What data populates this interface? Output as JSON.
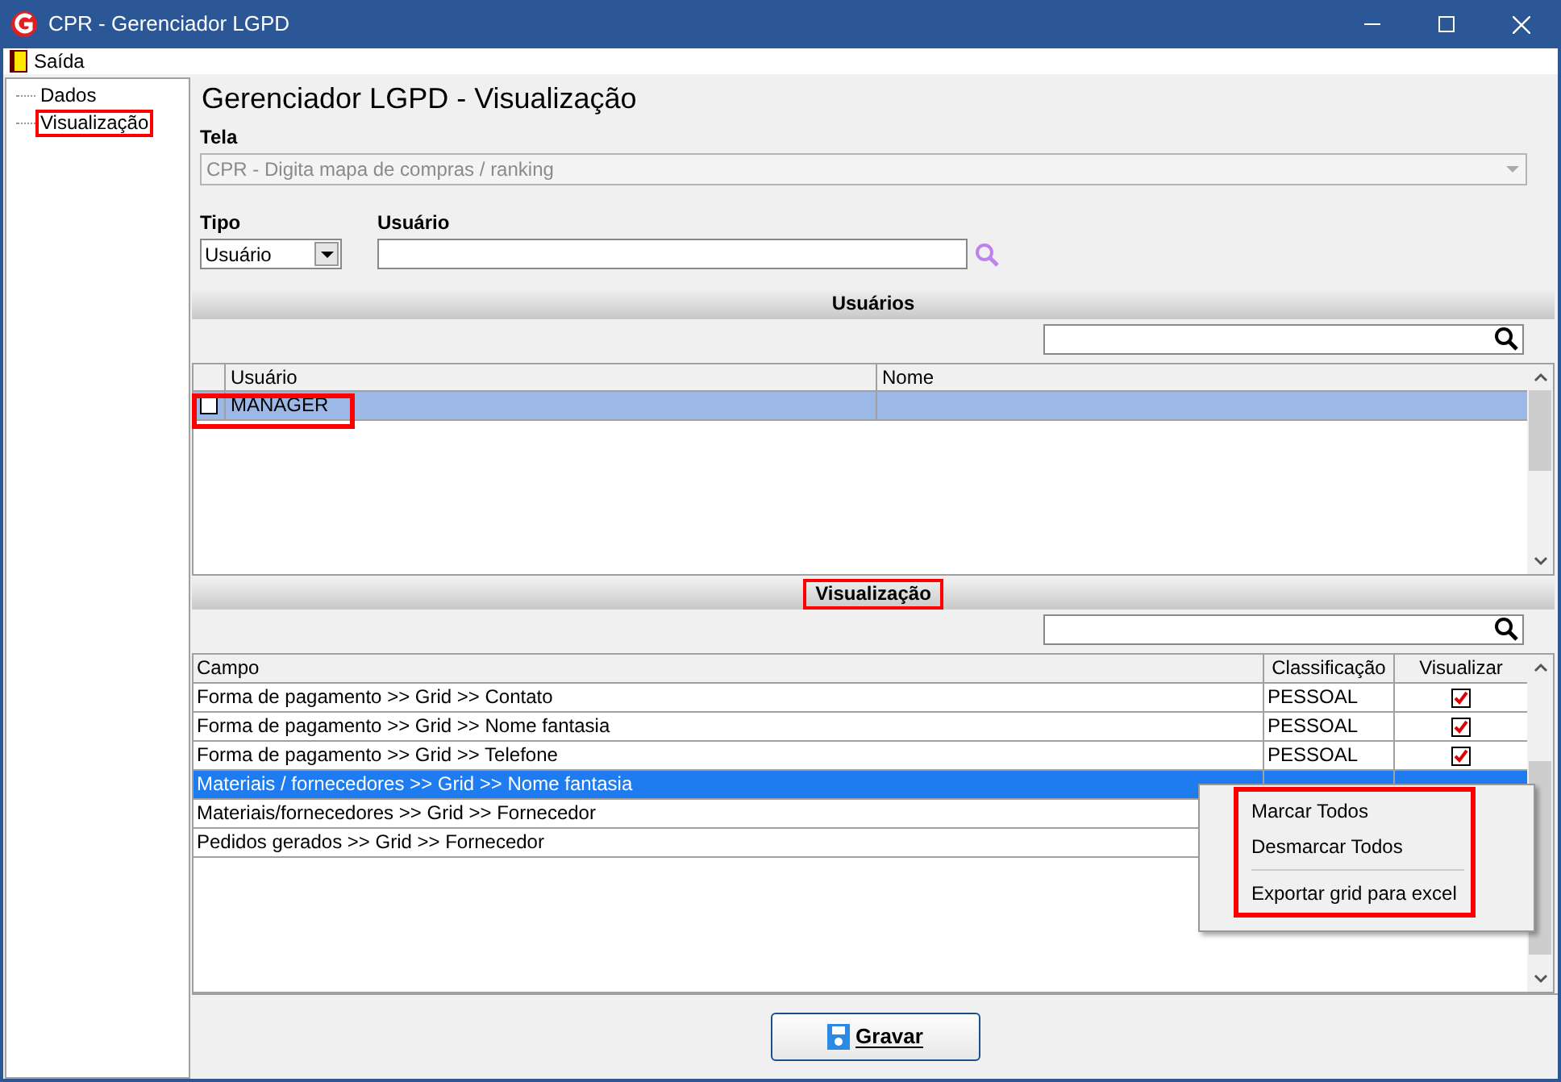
{
  "window": {
    "title": "CPR - Gerenciador LGPD"
  },
  "menu": [
    {
      "label": "Saída"
    }
  ],
  "sidebar": {
    "items": [
      {
        "label": "Dados",
        "selected": false
      },
      {
        "label": "Visualização",
        "selected": true
      }
    ]
  },
  "heading": "Gerenciador LGPD - Visualização",
  "tela": {
    "label": "Tela",
    "value": "CPR - Digita mapa de compras / ranking",
    "disabled": true
  },
  "tipo": {
    "label": "Tipo",
    "value": "Usuário"
  },
  "usuario": {
    "label": "Usuário"
  },
  "users_section": {
    "title": "Usuários",
    "columns": [
      "Usuário",
      "Nome"
    ],
    "rows": [
      {
        "usuario": "MANAGER",
        "nome": "",
        "checked": false,
        "selected": true
      }
    ]
  },
  "view_section": {
    "title": "Visualização",
    "columns": [
      "Campo",
      "Classificação",
      "Visualizar"
    ],
    "rows": [
      {
        "campo": "Forma de pagamento >> Grid >> Contato",
        "classificacao": "PESSOAL",
        "visualizar": true,
        "selected": false
      },
      {
        "campo": "Forma de pagamento >> Grid >> Nome fantasia",
        "classificacao": "PESSOAL",
        "visualizar": true,
        "selected": false
      },
      {
        "campo": "Forma de pagamento >> Grid >> Telefone",
        "classificacao": "PESSOAL",
        "visualizar": true,
        "selected": false
      },
      {
        "campo": "Materiais / fornecedores >> Grid >> Nome fantasia",
        "selected": true
      },
      {
        "campo": "Materiais/fornecedores >> Grid >> Fornecedor",
        "selected": false
      },
      {
        "campo": "Pedidos gerados >> Grid >> Fornecedor",
        "selected": false
      }
    ]
  },
  "context_menu": {
    "items": [
      {
        "kind": "item",
        "label": "Marcar Todos"
      },
      {
        "kind": "item",
        "label": "Desmarcar Todos"
      },
      {
        "kind": "separator"
      },
      {
        "kind": "item",
        "label": "Exportar grid para excel"
      }
    ]
  },
  "save_button": {
    "label": "Gravar"
  }
}
